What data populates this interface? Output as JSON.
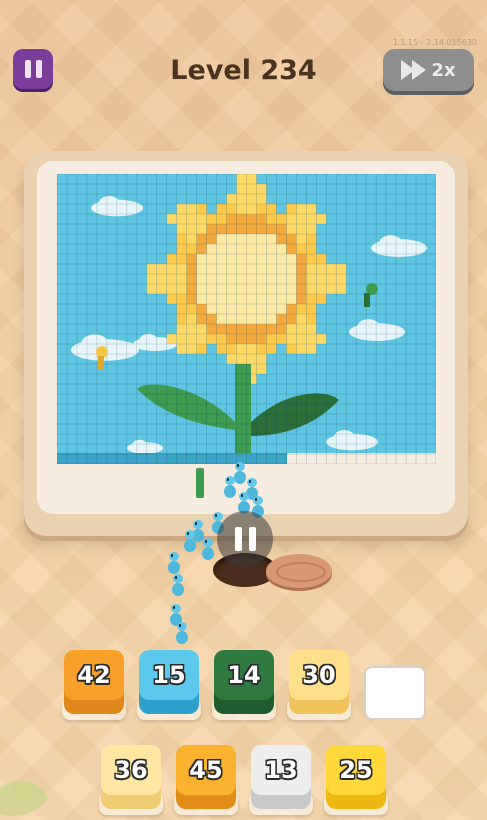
{
  "header": {
    "level_label": "Level 234",
    "speed_label": "2x",
    "version_text": "1.1.15 - 2.14.015630"
  },
  "icons": {
    "pause": "pause-icon",
    "fast_forward": "fast-forward-icon",
    "ant": "ant-icon"
  },
  "colors": {
    "sky": "#5ec6e2",
    "cloud": "#e8f6fb",
    "petal_light": "#ffd966",
    "petal_dark": "#f3a93c",
    "leaf": "#3e9b4f",
    "leaf_dark": "#2b6e38",
    "ant": "#4eb7dc"
  },
  "slots_row1": [
    {
      "count": "42",
      "color": "#f7a12a",
      "side": "#e0861a"
    },
    {
      "count": "15",
      "color": "#5cc8ec",
      "side": "#2f9fcb"
    },
    {
      "count": "14",
      "color": "#2f7a40",
      "side": "#1f5c2e"
    },
    {
      "count": "30",
      "color": "#ffe08a",
      "side": "#f0c25c"
    }
  ],
  "slots_row2": [
    {
      "count": "36",
      "color": "#ffe6a3",
      "side": "#f0cd72"
    },
    {
      "count": "45",
      "color": "#fbb22e",
      "side": "#e28d18"
    },
    {
      "count": "13",
      "color": "#eeeeee",
      "side": "#c9c9c9"
    },
    {
      "count": "25",
      "color": "#ffd93a",
      "side": "#eeb812"
    }
  ]
}
